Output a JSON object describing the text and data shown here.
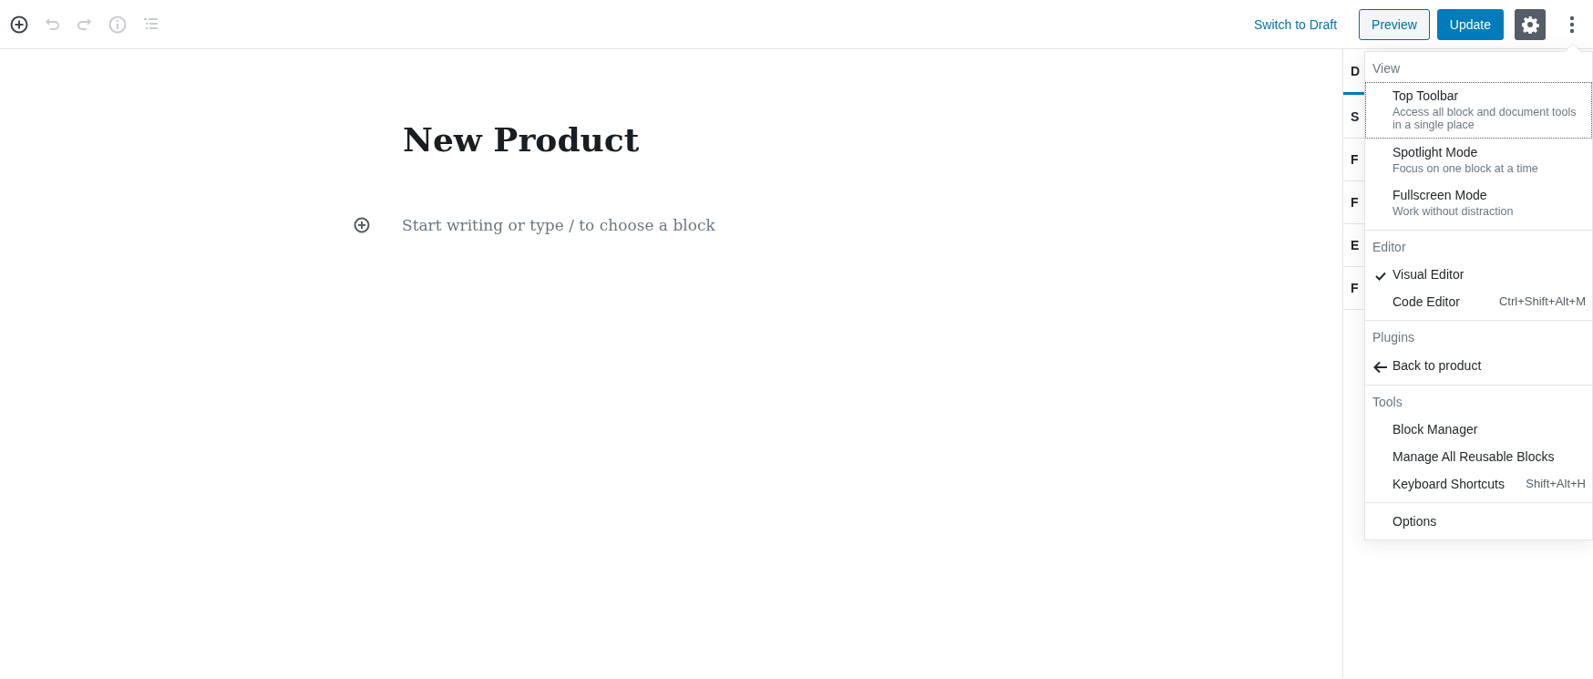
{
  "toolbar": {
    "tools": [
      {
        "kind": "add",
        "disabled": false
      },
      {
        "kind": "undo",
        "disabled": true
      },
      {
        "kind": "redo",
        "disabled": true
      },
      {
        "kind": "info",
        "disabled": true
      },
      {
        "kind": "outline",
        "disabled": true
      }
    ],
    "switch_link": "Switch to Draft",
    "preview_button": "Preview",
    "update_button": "Update",
    "settings": {
      "selected": true
    },
    "more_menu": {
      "expanded": true
    }
  },
  "post": {
    "title": "New Product",
    "placeholder": "Start writing or type / to choose a block"
  },
  "sidebar": {
    "tabs": [
      {
        "label": "D",
        "selected": true
      }
    ],
    "panels": [
      "S",
      "F",
      "F",
      "E",
      "F"
    ]
  },
  "menu": {
    "sections": [
      {
        "label": "View",
        "items": [
          {
            "kind": "toggle",
            "label": "Top Toolbar",
            "description": "Access all block and document tools in a single place",
            "checked": false,
            "focused": true
          },
          {
            "kind": "toggle",
            "label": "Spotlight Mode",
            "description": "Focus on one block at a time",
            "checked": false,
            "focused": false
          },
          {
            "kind": "toggle",
            "label": "Fullscreen Mode",
            "description": "Work without distraction",
            "checked": false,
            "focused": false
          }
        ]
      },
      {
        "label": "Editor",
        "items": [
          {
            "kind": "toggle",
            "label": "Visual Editor",
            "checked": true,
            "focused": false
          },
          {
            "kind": "toggle",
            "label": "Code Editor",
            "shortcut": "Ctrl+Shift+Alt+M",
            "checked": false,
            "focused": false
          }
        ]
      },
      {
        "label": "Plugins",
        "items": [
          {
            "kind": "back",
            "label": "Back to product"
          }
        ]
      },
      {
        "label": "Tools",
        "items": [
          {
            "kind": "plain",
            "label": "Block Manager"
          },
          {
            "kind": "plain",
            "label": "Manage All Reusable Blocks"
          },
          {
            "kind": "plain",
            "label": "Keyboard Shortcuts",
            "shortcut": "Shift+Alt+H"
          }
        ]
      },
      {
        "items": [
          {
            "kind": "plain",
            "label": "Options"
          }
        ]
      }
    ]
  }
}
